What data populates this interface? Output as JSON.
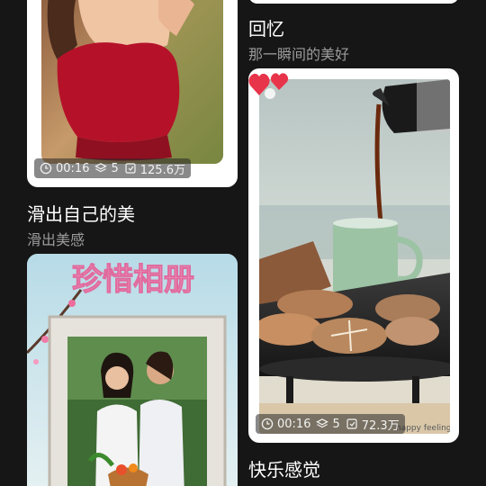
{
  "left_column": {
    "card1": {
      "duration": "00:16",
      "layers": "5",
      "uses": "125.6万"
    },
    "card1_title": "滑出自己的美",
    "card1_subtitle": "滑出美感",
    "card2": {
      "overlay_text": "珍惜相册"
    }
  },
  "right_column": {
    "card1_title": "回忆",
    "card1_subtitle": "那一瞬间的美好",
    "card2": {
      "duration": "00:16",
      "layers": "5",
      "uses": "72.3万",
      "watermark": "happy feeling"
    },
    "card2_title": "快乐感觉"
  },
  "colors": {
    "background": "#161616",
    "card_border": "#ffffff",
    "subtitle": "#9b9b9b",
    "heart": "#e8344a"
  },
  "icons": [
    "clock-icon",
    "layers-icon",
    "use-count-icon",
    "heart-icon"
  ]
}
